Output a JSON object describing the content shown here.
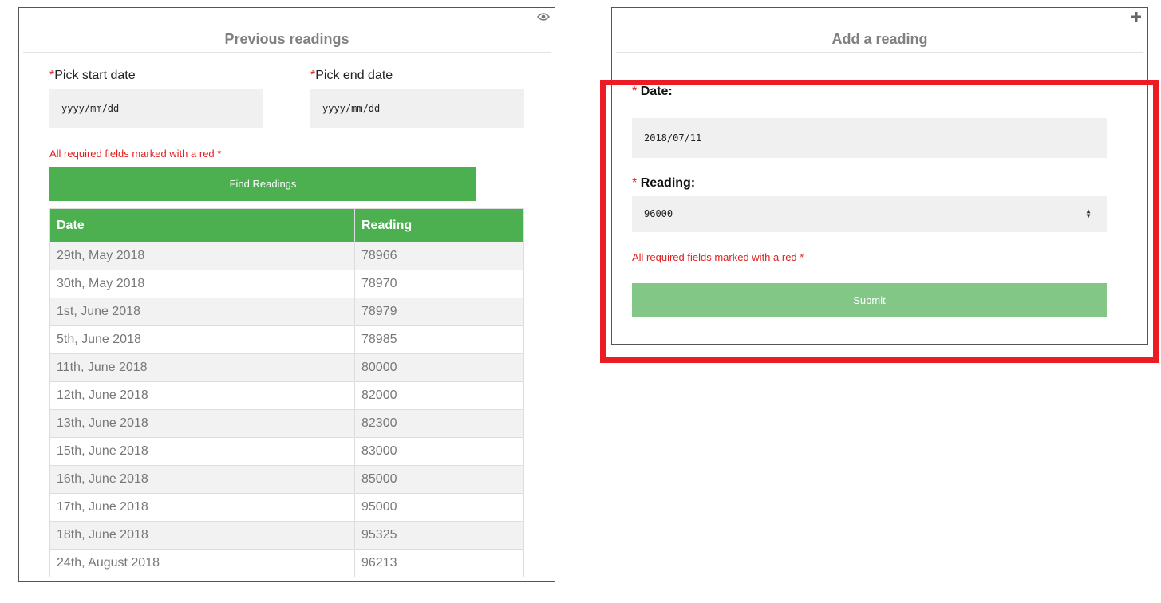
{
  "left_panel": {
    "title": "Previous readings",
    "corner_icon": "eye-icon",
    "start_date": {
      "required_mark": "*",
      "label": "Pick start date",
      "placeholder": "yyyy/mm/dd"
    },
    "end_date": {
      "required_mark": "*",
      "label": "Pick end date",
      "placeholder": "yyyy/mm/dd"
    },
    "required_note": "All required fields marked with a red *",
    "find_button": "Find Readings",
    "table": {
      "headers": [
        "Date",
        "Reading"
      ],
      "rows": [
        [
          "29th, May 2018",
          "78966"
        ],
        [
          "30th, May 2018",
          "78970"
        ],
        [
          "1st, June 2018",
          "78979"
        ],
        [
          "5th, June 2018",
          "78985"
        ],
        [
          "11th, June 2018",
          "80000"
        ],
        [
          "12th, June 2018",
          "82000"
        ],
        [
          "13th, June 2018",
          "82300"
        ],
        [
          "15th, June 2018",
          "83000"
        ],
        [
          "16th, June 2018",
          "85000"
        ],
        [
          "17th, June 2018",
          "95000"
        ],
        [
          "18th, June 2018",
          "95325"
        ],
        [
          "24th, August 2018",
          "96213"
        ]
      ]
    }
  },
  "right_panel": {
    "title": "Add a reading",
    "corner_icon": "plus-icon",
    "date": {
      "required_mark": "*",
      "label": "Date:",
      "value": "2018/07/11"
    },
    "reading": {
      "required_mark": "*",
      "label": "Reading:",
      "value": "96000"
    },
    "required_note": "All required fields marked with a red *",
    "submit_button": "Submit"
  },
  "colors": {
    "accent_green": "#4caf50",
    "submit_green": "#82c785",
    "required_red": "#e02020",
    "highlight_red": "#ed1c24"
  }
}
